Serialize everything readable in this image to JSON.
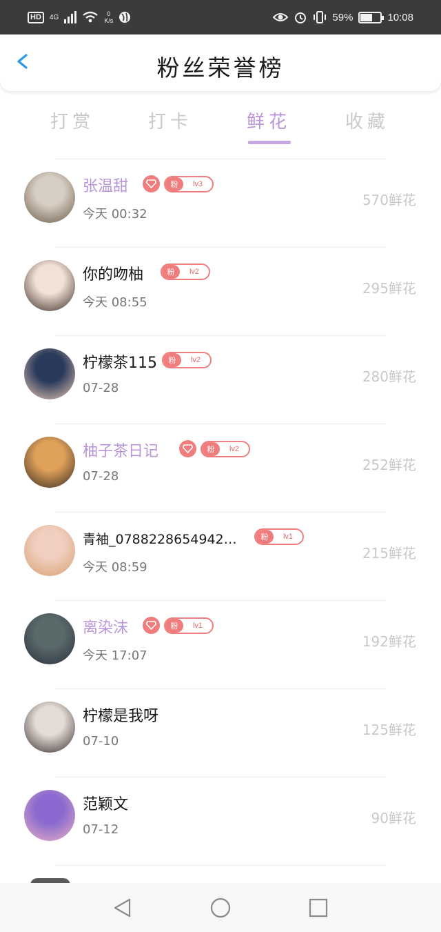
{
  "status_bar": {
    "hd": "HD",
    "network": "4G",
    "speed_value": "0",
    "speed_unit": "K/s",
    "battery": "59%",
    "battery_level": 0.59,
    "time": "10:08"
  },
  "header": {
    "title": "粉丝荣誉榜"
  },
  "tabs": [
    {
      "label": "打赏",
      "active": false
    },
    {
      "label": "打卡",
      "active": false
    },
    {
      "label": "鲜花",
      "active": true
    },
    {
      "label": "收藏",
      "active": false
    }
  ],
  "fan_label": "粉",
  "list": [
    {
      "name": "张温甜",
      "vip": true,
      "level": "lv3",
      "time": "今天 00:32",
      "amount": "570鲜花",
      "avatar_colors": [
        "#d8cfc4",
        "#6a5a48"
      ]
    },
    {
      "name": "你的吻柚",
      "vip": false,
      "level": "lv2",
      "time": "今天 08:55",
      "amount": "295鲜花",
      "avatar_colors": [
        "#f1e1d6",
        "#3b2b25"
      ]
    },
    {
      "name": "柠檬茶115",
      "vip": false,
      "level": "lv2",
      "time": "07-28",
      "amount": "280鲜花",
      "avatar_colors": [
        "#2a3a5a",
        "#e8c9b5"
      ]
    },
    {
      "name": "柚子茶日记",
      "vip": true,
      "level": "lv2",
      "time": "07-28",
      "amount": "252鲜花",
      "avatar_colors": [
        "#e0a25a",
        "#3a2a22"
      ]
    },
    {
      "name": "青袖_0788228654942…",
      "vip": false,
      "level": "lv1",
      "time": "今天 08:59",
      "amount": "215鲜花",
      "avatar_colors": [
        "#f0cfc0",
        "#d8a070"
      ]
    },
    {
      "name": "离染沫",
      "vip": true,
      "level": "lv1",
      "time": "今天 17:07",
      "amount": "192鲜花",
      "avatar_colors": [
        "#5a6a6a",
        "#2a3040"
      ]
    },
    {
      "name": "柠檬是我呀",
      "vip": false,
      "level": "",
      "time": "07-10",
      "amount": "125鲜花",
      "avatar_colors": [
        "#e4dcd6",
        "#3a3030"
      ]
    },
    {
      "name": "范颖文",
      "vip": false,
      "level": "",
      "time": "07-12",
      "amount": "90鲜花",
      "avatar_colors": [
        "#8a6ad0",
        "#e8b0c0"
      ]
    }
  ]
}
